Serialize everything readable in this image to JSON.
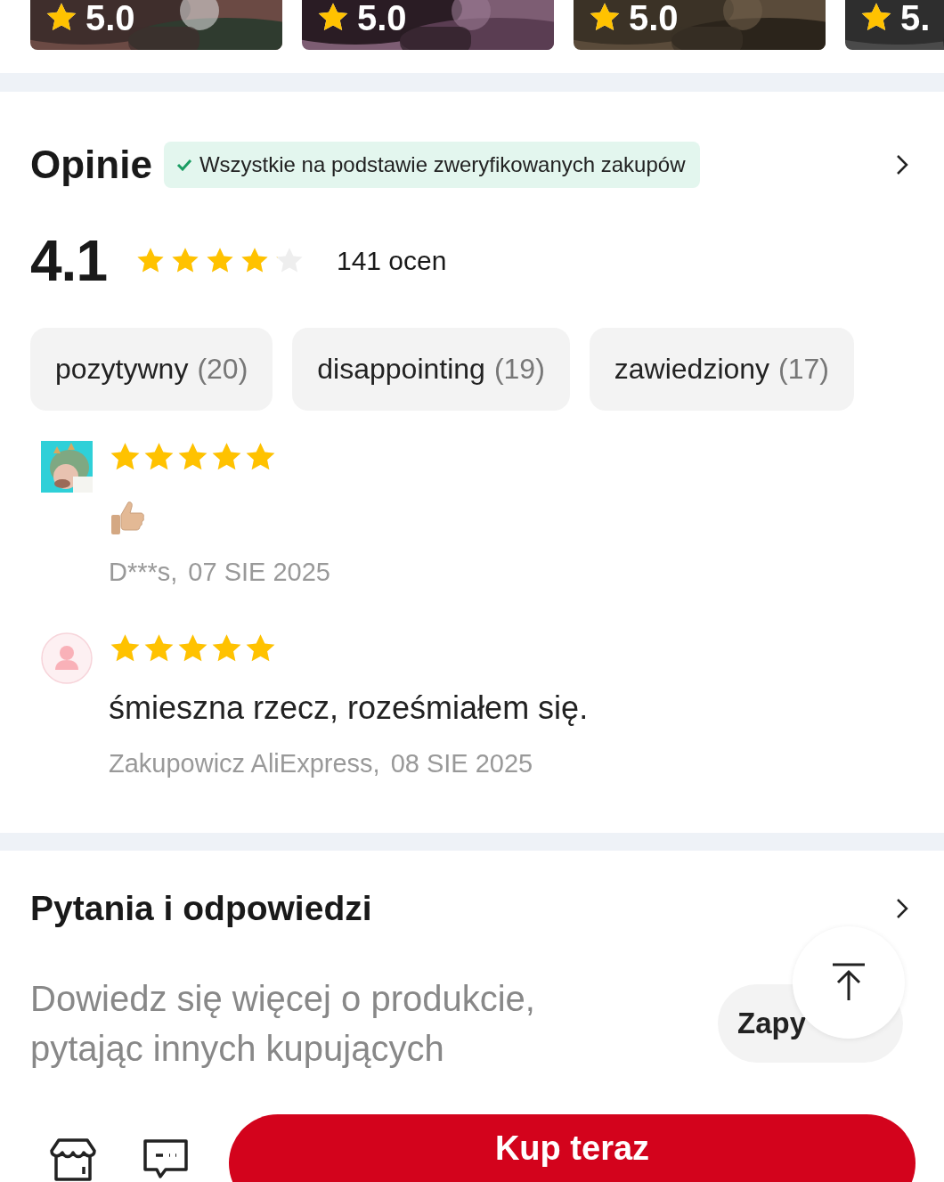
{
  "photo_strip": [
    {
      "rating": "5.0"
    },
    {
      "rating": "5.0"
    },
    {
      "rating": "5.0"
    },
    {
      "rating": "5."
    }
  ],
  "reviews_section": {
    "title": "Opinie",
    "verified_badge": "Wszystkie na podstawie zweryfikowanych zakupów",
    "average": "4.1",
    "stars": 4.1,
    "rating_count": "141 ocen",
    "filters": [
      {
        "label": "pozytywny",
        "count": "(20)"
      },
      {
        "label": "disappointing",
        "count": "(19)"
      },
      {
        "label": "zawiedziony",
        "count": "(17)"
      }
    ],
    "reviews": [
      {
        "avatar_photo": true,
        "stars": 5,
        "kind": "thumbs-up",
        "author": "D***s,",
        "date": "07 SIE 2025"
      },
      {
        "avatar_photo": false,
        "stars": 5,
        "kind": "text",
        "text": "śmieszna rzecz, roześmiałem się.",
        "author": "Zakupowicz AliExpress,",
        "date": "08 SIE 2025"
      }
    ]
  },
  "questions_section": {
    "title": "Pytania i odpowiedzi",
    "hint": "Dowiedz się więcej o produkcie, pytając innych kupujących",
    "ask_button": "Zapy"
  },
  "bottom_bar": {
    "buy_button": "Kup teraz"
  }
}
